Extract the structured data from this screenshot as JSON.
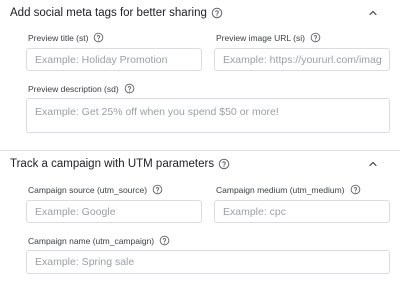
{
  "social_section": {
    "title": "Add social meta tags for better sharing",
    "help_icon": "help-circle-icon",
    "collapse_icon": "chevron-up-icon",
    "preview_title": {
      "label": "Preview title (st)",
      "placeholder": "Example: Holiday Promotion"
    },
    "preview_image_url": {
      "label": "Preview image URL (si)",
      "placeholder": "Example: https://yoururl.com/image.png"
    },
    "preview_description": {
      "label": "Preview description (sd)",
      "placeholder": "Example: Get 25% off when you spend $50 or more!"
    }
  },
  "utm_section": {
    "title": "Track a campaign with UTM parameters",
    "help_icon": "help-circle-icon",
    "collapse_icon": "chevron-up-icon",
    "campaign_source": {
      "label": "Campaign source (utm_source)",
      "placeholder": "Example: Google"
    },
    "campaign_medium": {
      "label": "Campaign medium (utm_medium)",
      "placeholder": "Example: cpc"
    },
    "campaign_name": {
      "label": "Campaign name (utm_campaign)",
      "placeholder": "Example: Spring sale"
    }
  },
  "colors": {
    "text": "#202124",
    "label": "#3c4043",
    "placeholder": "#9aa0a6",
    "border": "#dadce0"
  }
}
